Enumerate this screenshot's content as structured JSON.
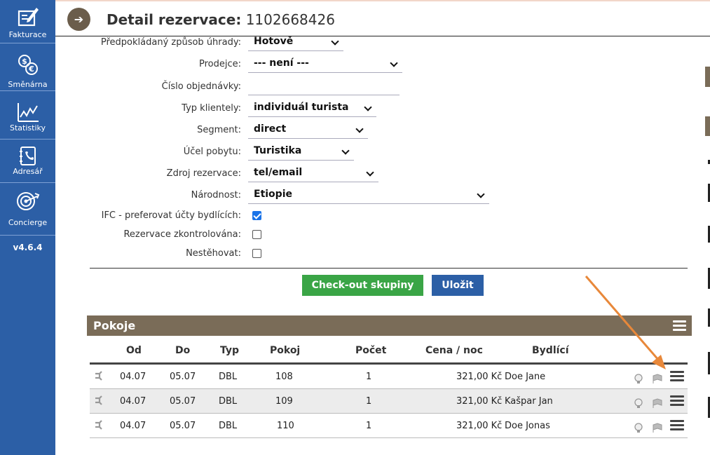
{
  "sidebar": {
    "items": [
      {
        "label": "Fakturace",
        "icon": "invoice-icon"
      },
      {
        "label": "Směnárna",
        "icon": "currency-exchange-icon"
      },
      {
        "label": "Statistiky",
        "icon": "chart-icon"
      },
      {
        "label": "Adresář",
        "icon": "address-book-icon"
      },
      {
        "label": "Concierge",
        "icon": "target-icon"
      }
    ],
    "version": "v4.6.4"
  },
  "header": {
    "title_prefix": "Detail rezervace:",
    "reservation_number": "1102668426",
    "back_icon": "arrow-right-icon"
  },
  "form": {
    "payment_method": {
      "label": "Předpokládaný způsob úhrady:",
      "value": "Hotově"
    },
    "seller": {
      "label": "Prodejce:",
      "value": "--- není ---"
    },
    "order_number": {
      "label": "Číslo objednávky:",
      "value": ""
    },
    "client_type": {
      "label": "Typ klientely:",
      "value": "individuál turista"
    },
    "segment": {
      "label": "Segment:",
      "value": "direct"
    },
    "stay_purpose": {
      "label": "Účel pobytu:",
      "value": "Turistika"
    },
    "reservation_source": {
      "label": "Zdroj rezervace:",
      "value": "tel/email"
    },
    "nationality": {
      "label": "Národnost:",
      "value": "Etiopie"
    },
    "ifc": {
      "label": "IFC - preferovat účty bydlících:",
      "checked": true
    },
    "checked_reservation": {
      "label": "Rezervace zkontrolována:",
      "checked": false
    },
    "no_move": {
      "label": "Nestěhovat:",
      "checked": false
    }
  },
  "buttons": {
    "checkout_group": "Check-out skupiny",
    "save": "Uložit"
  },
  "rooms": {
    "title": "Pokoje",
    "columns": {
      "from": "Od",
      "to": "Do",
      "type": "Typ",
      "room": "Pokoj",
      "count": "Počet",
      "price": "Cena / noc",
      "guest": "Bydlící"
    },
    "rows": [
      {
        "from": "04.07",
        "to": "05.07",
        "type": "DBL",
        "room": "108",
        "count": "1",
        "price": "321,00 Kč",
        "guest": "Doe Jane"
      },
      {
        "from": "04.07",
        "to": "05.07",
        "type": "DBL",
        "room": "109",
        "count": "1",
        "price": "321,00 Kč",
        "guest": "Kašpar Jan"
      },
      {
        "from": "04.07",
        "to": "05.07",
        "type": "DBL",
        "room": "110",
        "count": "1",
        "price": "321,00 Kč",
        "guest": "Doe Jonas"
      }
    ]
  },
  "colors": {
    "sidebar": "#2c5fa6",
    "section_header": "#7a6c58",
    "checkout_button": "#3aa546",
    "save_button": "#2c5fa6",
    "annotation_arrow": "#e8883a"
  }
}
